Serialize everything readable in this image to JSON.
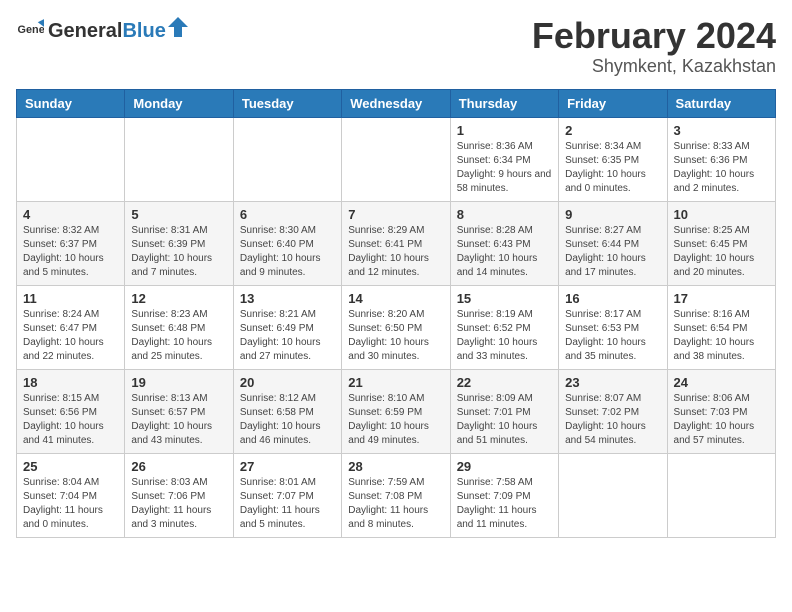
{
  "header": {
    "logo_general": "General",
    "logo_blue": "Blue",
    "main_title": "February 2024",
    "sub_title": "Shymkent, Kazakhstan"
  },
  "calendar": {
    "days_of_week": [
      "Sunday",
      "Monday",
      "Tuesday",
      "Wednesday",
      "Thursday",
      "Friday",
      "Saturday"
    ],
    "weeks": [
      [
        {
          "day": "",
          "info": ""
        },
        {
          "day": "",
          "info": ""
        },
        {
          "day": "",
          "info": ""
        },
        {
          "day": "",
          "info": ""
        },
        {
          "day": "1",
          "info": "Sunrise: 8:36 AM\nSunset: 6:34 PM\nDaylight: 9 hours and 58 minutes."
        },
        {
          "day": "2",
          "info": "Sunrise: 8:34 AM\nSunset: 6:35 PM\nDaylight: 10 hours and 0 minutes."
        },
        {
          "day": "3",
          "info": "Sunrise: 8:33 AM\nSunset: 6:36 PM\nDaylight: 10 hours and 2 minutes."
        }
      ],
      [
        {
          "day": "4",
          "info": "Sunrise: 8:32 AM\nSunset: 6:37 PM\nDaylight: 10 hours and 5 minutes."
        },
        {
          "day": "5",
          "info": "Sunrise: 8:31 AM\nSunset: 6:39 PM\nDaylight: 10 hours and 7 minutes."
        },
        {
          "day": "6",
          "info": "Sunrise: 8:30 AM\nSunset: 6:40 PM\nDaylight: 10 hours and 9 minutes."
        },
        {
          "day": "7",
          "info": "Sunrise: 8:29 AM\nSunset: 6:41 PM\nDaylight: 10 hours and 12 minutes."
        },
        {
          "day": "8",
          "info": "Sunrise: 8:28 AM\nSunset: 6:43 PM\nDaylight: 10 hours and 14 minutes."
        },
        {
          "day": "9",
          "info": "Sunrise: 8:27 AM\nSunset: 6:44 PM\nDaylight: 10 hours and 17 minutes."
        },
        {
          "day": "10",
          "info": "Sunrise: 8:25 AM\nSunset: 6:45 PM\nDaylight: 10 hours and 20 minutes."
        }
      ],
      [
        {
          "day": "11",
          "info": "Sunrise: 8:24 AM\nSunset: 6:47 PM\nDaylight: 10 hours and 22 minutes."
        },
        {
          "day": "12",
          "info": "Sunrise: 8:23 AM\nSunset: 6:48 PM\nDaylight: 10 hours and 25 minutes."
        },
        {
          "day": "13",
          "info": "Sunrise: 8:21 AM\nSunset: 6:49 PM\nDaylight: 10 hours and 27 minutes."
        },
        {
          "day": "14",
          "info": "Sunrise: 8:20 AM\nSunset: 6:50 PM\nDaylight: 10 hours and 30 minutes."
        },
        {
          "day": "15",
          "info": "Sunrise: 8:19 AM\nSunset: 6:52 PM\nDaylight: 10 hours and 33 minutes."
        },
        {
          "day": "16",
          "info": "Sunrise: 8:17 AM\nSunset: 6:53 PM\nDaylight: 10 hours and 35 minutes."
        },
        {
          "day": "17",
          "info": "Sunrise: 8:16 AM\nSunset: 6:54 PM\nDaylight: 10 hours and 38 minutes."
        }
      ],
      [
        {
          "day": "18",
          "info": "Sunrise: 8:15 AM\nSunset: 6:56 PM\nDaylight: 10 hours and 41 minutes."
        },
        {
          "day": "19",
          "info": "Sunrise: 8:13 AM\nSunset: 6:57 PM\nDaylight: 10 hours and 43 minutes."
        },
        {
          "day": "20",
          "info": "Sunrise: 8:12 AM\nSunset: 6:58 PM\nDaylight: 10 hours and 46 minutes."
        },
        {
          "day": "21",
          "info": "Sunrise: 8:10 AM\nSunset: 6:59 PM\nDaylight: 10 hours and 49 minutes."
        },
        {
          "day": "22",
          "info": "Sunrise: 8:09 AM\nSunset: 7:01 PM\nDaylight: 10 hours and 51 minutes."
        },
        {
          "day": "23",
          "info": "Sunrise: 8:07 AM\nSunset: 7:02 PM\nDaylight: 10 hours and 54 minutes."
        },
        {
          "day": "24",
          "info": "Sunrise: 8:06 AM\nSunset: 7:03 PM\nDaylight: 10 hours and 57 minutes."
        }
      ],
      [
        {
          "day": "25",
          "info": "Sunrise: 8:04 AM\nSunset: 7:04 PM\nDaylight: 11 hours and 0 minutes."
        },
        {
          "day": "26",
          "info": "Sunrise: 8:03 AM\nSunset: 7:06 PM\nDaylight: 11 hours and 3 minutes."
        },
        {
          "day": "27",
          "info": "Sunrise: 8:01 AM\nSunset: 7:07 PM\nDaylight: 11 hours and 5 minutes."
        },
        {
          "day": "28",
          "info": "Sunrise: 7:59 AM\nSunset: 7:08 PM\nDaylight: 11 hours and 8 minutes."
        },
        {
          "day": "29",
          "info": "Sunrise: 7:58 AM\nSunset: 7:09 PM\nDaylight: 11 hours and 11 minutes."
        },
        {
          "day": "",
          "info": ""
        },
        {
          "day": "",
          "info": ""
        }
      ]
    ]
  }
}
